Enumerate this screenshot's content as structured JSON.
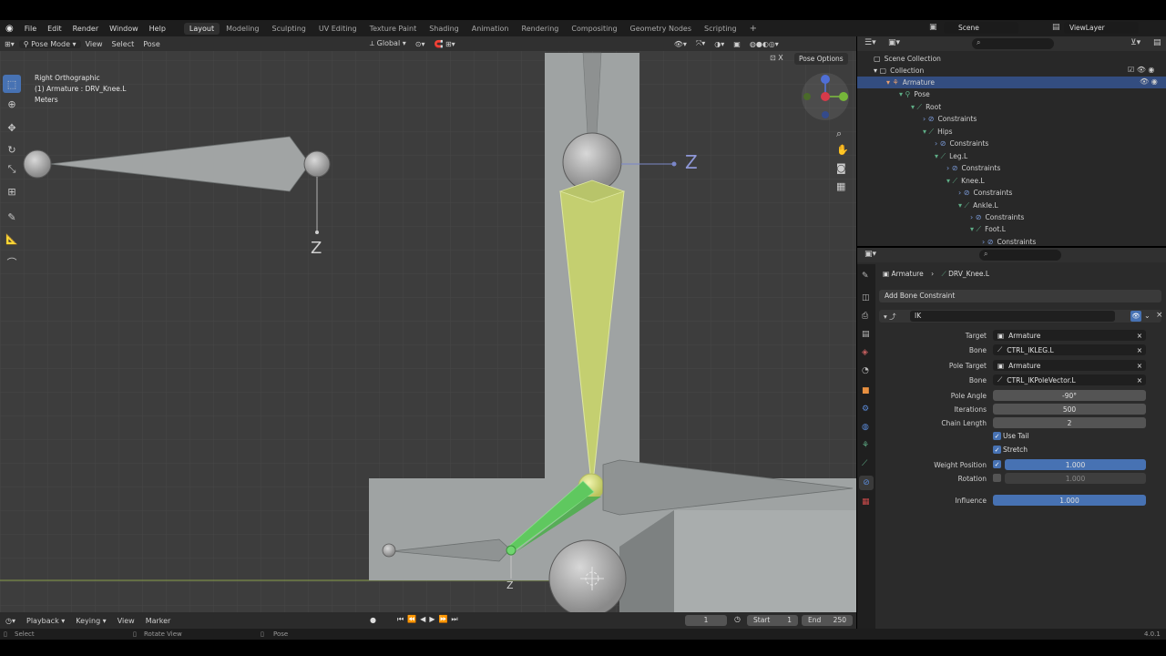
{
  "menus": [
    "File",
    "Edit",
    "Render",
    "Window",
    "Help"
  ],
  "workspaces": [
    "Layout",
    "Modeling",
    "Sculpting",
    "UV Editing",
    "Texture Paint",
    "Shading",
    "Animation",
    "Rendering",
    "Compositing",
    "Geometry Nodes",
    "Scripting"
  ],
  "active_workspace": "Layout",
  "scene_name": "Scene",
  "view_layer": "ViewLayer",
  "viewport_header": {
    "mode": "Pose Mode",
    "view": "View",
    "select": "Select",
    "pose": "Pose",
    "orientation": "Global",
    "pose_options": "Pose Options"
  },
  "overlay_text": {
    "view_name": "Right Orthographic",
    "object": "(1) Armature : DRV_Knee.L",
    "units": "Meters"
  },
  "axis_labels": {
    "z1": "Z",
    "z2": "Z",
    "z3": "Z"
  },
  "outliner": {
    "items": [
      {
        "label": "Scene Collection",
        "depth": 0
      },
      {
        "label": "Collection",
        "depth": 1
      },
      {
        "label": "Armature",
        "depth": 2
      },
      {
        "label": "Pose",
        "depth": 3
      },
      {
        "label": "Root",
        "depth": 4
      },
      {
        "label": "Constraints",
        "depth": 5
      },
      {
        "label": "Hips",
        "depth": 5
      },
      {
        "label": "Constraints",
        "depth": 6
      },
      {
        "label": "Leg.L",
        "depth": 6
      },
      {
        "label": "Constraints",
        "depth": 7
      },
      {
        "label": "Knee.L",
        "depth": 7
      },
      {
        "label": "Constraints",
        "depth": 8
      },
      {
        "label": "Ankle.L",
        "depth": 8
      },
      {
        "label": "Constraints",
        "depth": 9
      },
      {
        "label": "Foot.L",
        "depth": 9
      },
      {
        "label": "Constraints",
        "depth": 10
      }
    ]
  },
  "properties": {
    "breadcrumb_object": "Armature",
    "breadcrumb_bone": "DRV_Knee.L",
    "add_constraint": "Add Bone Constraint",
    "constraint_name": "IK",
    "target_label": "Target",
    "target_value": "Armature",
    "bone_label": "Bone",
    "bone_value": "CTRL_IKLEG.L",
    "pole_target_label": "Pole Target",
    "pole_target_value": "Armature",
    "pole_bone_label": "Bone",
    "pole_bone_value": "CTRL_IKPoleVector.L",
    "pole_angle_label": "Pole Angle",
    "pole_angle_value": "-90°",
    "iterations_label": "Iterations",
    "iterations_value": "500",
    "chain_length_label": "Chain Length",
    "chain_length_value": "2",
    "use_tail_label": "Use Tail",
    "stretch_label": "Stretch",
    "weight_position_label": "Weight Position",
    "weight_position_value": "1.000",
    "rotation_label": "Rotation",
    "rotation_value": "1.000",
    "influence_label": "Influence",
    "influence_value": "1.000"
  },
  "timeline": {
    "playback": "Playback",
    "keying": "Keying",
    "view": "View",
    "marker": "Marker",
    "current_frame": "1",
    "start_label": "Start",
    "start_value": "1",
    "end_label": "End",
    "end_value": "250"
  },
  "statusbar": {
    "select": "Select",
    "rotate_view": "Rotate View",
    "pose": "Pose",
    "version": "4.0.1"
  },
  "colors": {
    "accent_blue": "#4772b3",
    "bone_yellow": "#c8d47a",
    "bone_green": "#6fd66f"
  }
}
